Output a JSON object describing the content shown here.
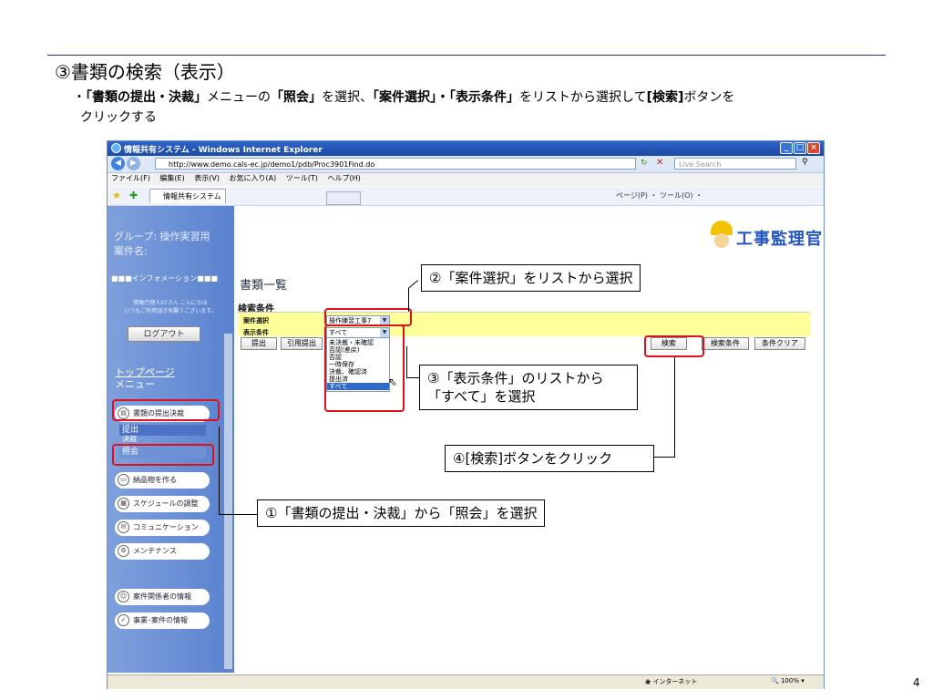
{
  "slide": {
    "title": "③書類の検索（表示）",
    "bullet_prefix": "・",
    "bullet_1": "「書類の提出・決裁」",
    "bullet_2": "メニューの",
    "bullet_3": "「照会」",
    "bullet_4": "を選択、",
    "bullet_5": "「案件選択」・「表示条件」",
    "bullet_6": "をリストから選択して",
    "bullet_7": "[検索]",
    "bullet_8": "ボタンを",
    "bullet_line2": "クリックする",
    "page_number": "4"
  },
  "browser": {
    "window_title": "情報共有システム - Windows Internet Explorer",
    "url": "http://www.demo.cals-ec.jp/demo1/pdb/Proc3901Find.do",
    "search_placeholder": "Live Search",
    "menu": [
      "ファイル(F)",
      "編集(E)",
      "表示(V)",
      "お気に入り(A)",
      "ツール(T)",
      "ヘルプ(H)"
    ],
    "tab_label": "情報共有システム",
    "toolbar_tools": "ページ(P) ・ ツール(O) ・",
    "status_zone": "インターネット",
    "status_zoom": "100%"
  },
  "sidebar": {
    "group_line1": "グループ: 操作実習用",
    "group_line2": "案件名:",
    "info_header": "■■■インフォメーション■■■",
    "welcome_line1": "情報代理人07さん こんにちは",
    "welcome_line2": "いつもご利用頂き有難うございます。",
    "logout_label": "ログアウト",
    "top_page_label": "トップページ",
    "menu_label": "メニュー",
    "menu_items": {
      "doc_submit": "書類の提出決裁",
      "sub_submit": "提出",
      "sub_approve": "決裁",
      "sub_inquiry": "照会",
      "deliverables": "納品物を作る",
      "schedule": "スケジュールの調整",
      "communication": "コミュニケーション",
      "maintenance": "メンテナンス",
      "stakeholders": "案件関係者の情報",
      "projects": "事業･案件の情報"
    }
  },
  "content": {
    "logo_text": "工事監理官",
    "page_title": "書類一覧",
    "search_conditions": "検索条件",
    "case_select_label": "案件選択",
    "display_cond_label": "表示条件",
    "case_select_value": "操作練習工事7",
    "display_cond_value": "すべて",
    "dropdown_options": [
      "未決裁・未確認",
      "否認(差戻)",
      "否認",
      "一時保存",
      "決裁、確認済",
      "提出済",
      "すべて"
    ],
    "btn_submit": "提出",
    "btn_cite": "引用提出",
    "btn_search": "検索",
    "btn_search_cond": "検索条件",
    "btn_clear": "条件クリア"
  },
  "callouts": {
    "c1": "①「書類の提出・決裁」から「照会」を選択",
    "c2": "②「案件選択」をリストから選択",
    "c3_line1": "③「表示条件」のリストから",
    "c3_line2": "「すべて」を選択",
    "c4": "④[検索]ボタンをクリック"
  },
  "colors": {
    "highlight": "#e0101b",
    "sidebar": "#5a82cf",
    "condition_panel": "#ffff99",
    "title_rule": "#1f3a7a"
  }
}
